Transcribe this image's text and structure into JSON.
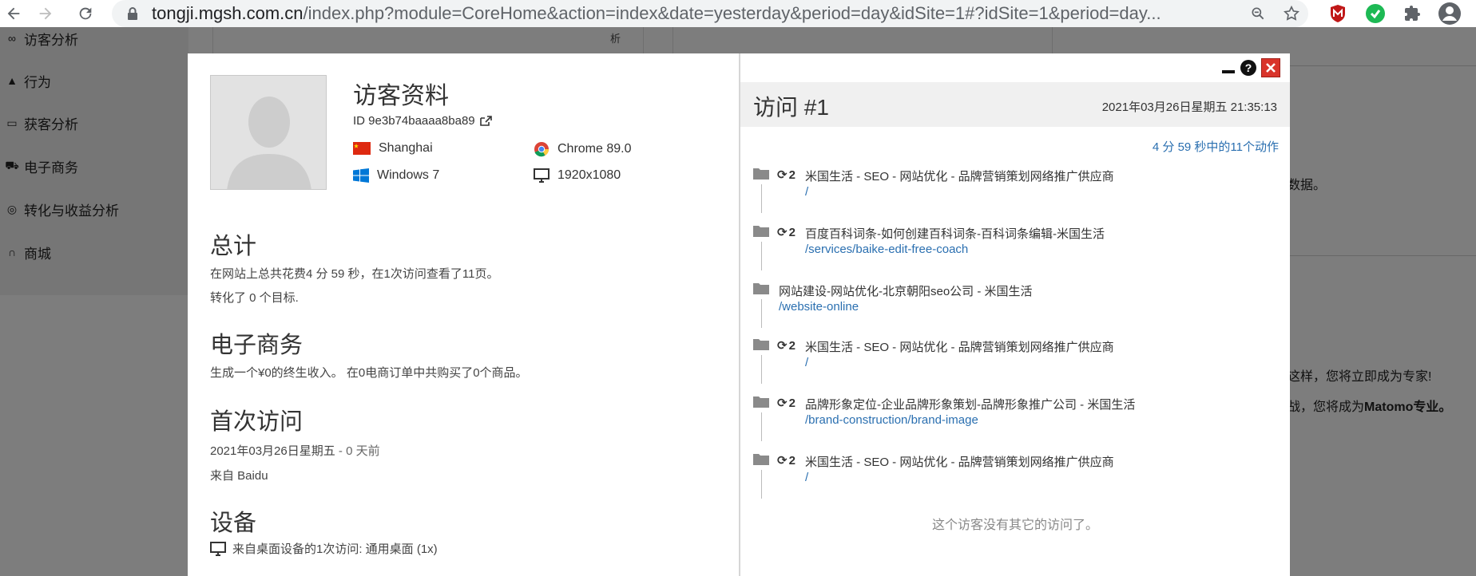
{
  "browser": {
    "url_host": "tongji.mgsh.com.cn",
    "url_path": "/index.php?module=CoreHome&action=index&date=yesterday&period=day&idSite=1#?idSite=1&period=day..."
  },
  "background": {
    "nav": [
      {
        "icon": "binoculars-icon",
        "label": "访客分析"
      },
      {
        "icon": "bell-icon",
        "label": "行为"
      },
      {
        "icon": "window-icon",
        "label": "获客分析"
      },
      {
        "icon": "cart-icon",
        "label": "电子商务"
      },
      {
        "icon": "target-icon",
        "label": "转化与收益分析"
      },
      {
        "icon": "headset-icon",
        "label": "商城"
      }
    ],
    "top_fragment": "析",
    "right_fragment_1": "数据。",
    "right_fragment_2": "这样，您将立即成为专家!",
    "right_fragment_3": "战，您将成为",
    "right_fragment_3_bold": "Matomo专业。"
  },
  "profile": {
    "title": "访客资料",
    "visitor_id": "ID 9e3b74baaaa8ba89",
    "location": "Shanghai",
    "browser": "Chrome 89.0",
    "os": "Windows 7",
    "resolution": "1920x1080"
  },
  "summary": {
    "heading": "总计",
    "line1": "在网站上总共花费4 分 59 秒，在1次访问查看了11页。",
    "line2": "转化了 0 个目标."
  },
  "ecommerce": {
    "heading": "电子商务",
    "line1": "生成一个¥0的终生收入。 在0电商订单中共购买了0个商品。"
  },
  "first_visit": {
    "heading": "首次访问",
    "date": "2021年03月26日星期五",
    "ago": " - 0 天前",
    "referrer": "来自 Baidu"
  },
  "devices": {
    "heading": "设备",
    "line1": "来自桌面设备的1次访问: 通用桌面 (1x)"
  },
  "visit": {
    "title": "访问 #1",
    "datetime": "2021年03月26日星期五 21:35:13",
    "actions_summary": "4 分 59 秒中的11个动作",
    "actions": [
      {
        "count": "2",
        "title": "米国生活 - SEO - 网站优化 - 品牌营销策划网络推广供应商",
        "path": "/"
      },
      {
        "count": "2",
        "title": "百度百科词条-如何创建百科词条-百科词条编辑-米国生活",
        "path": "/services/baike-edit-free-coach"
      },
      {
        "count": "",
        "title": "网站建设-网站优化-北京朝阳seo公司 - 米国生活",
        "path": "/website-online"
      },
      {
        "count": "2",
        "title": "米国生活 - SEO - 网站优化 - 品牌营销策划网络推广供应商",
        "path": "/"
      },
      {
        "count": "2",
        "title": "品牌形象定位-企业品牌形象策划-品牌形象推广公司 - 米国生活",
        "path": "/brand-construction/brand-image"
      },
      {
        "count": "2",
        "title": "米国生活 - SEO - 网站优化 - 品牌营销策划网络推广供应商",
        "path": "/"
      }
    ],
    "no_more": "这个访客没有其它的访问了。"
  },
  "colors": {
    "link": "#2a6fb0",
    "close_red": "#d9342b"
  }
}
